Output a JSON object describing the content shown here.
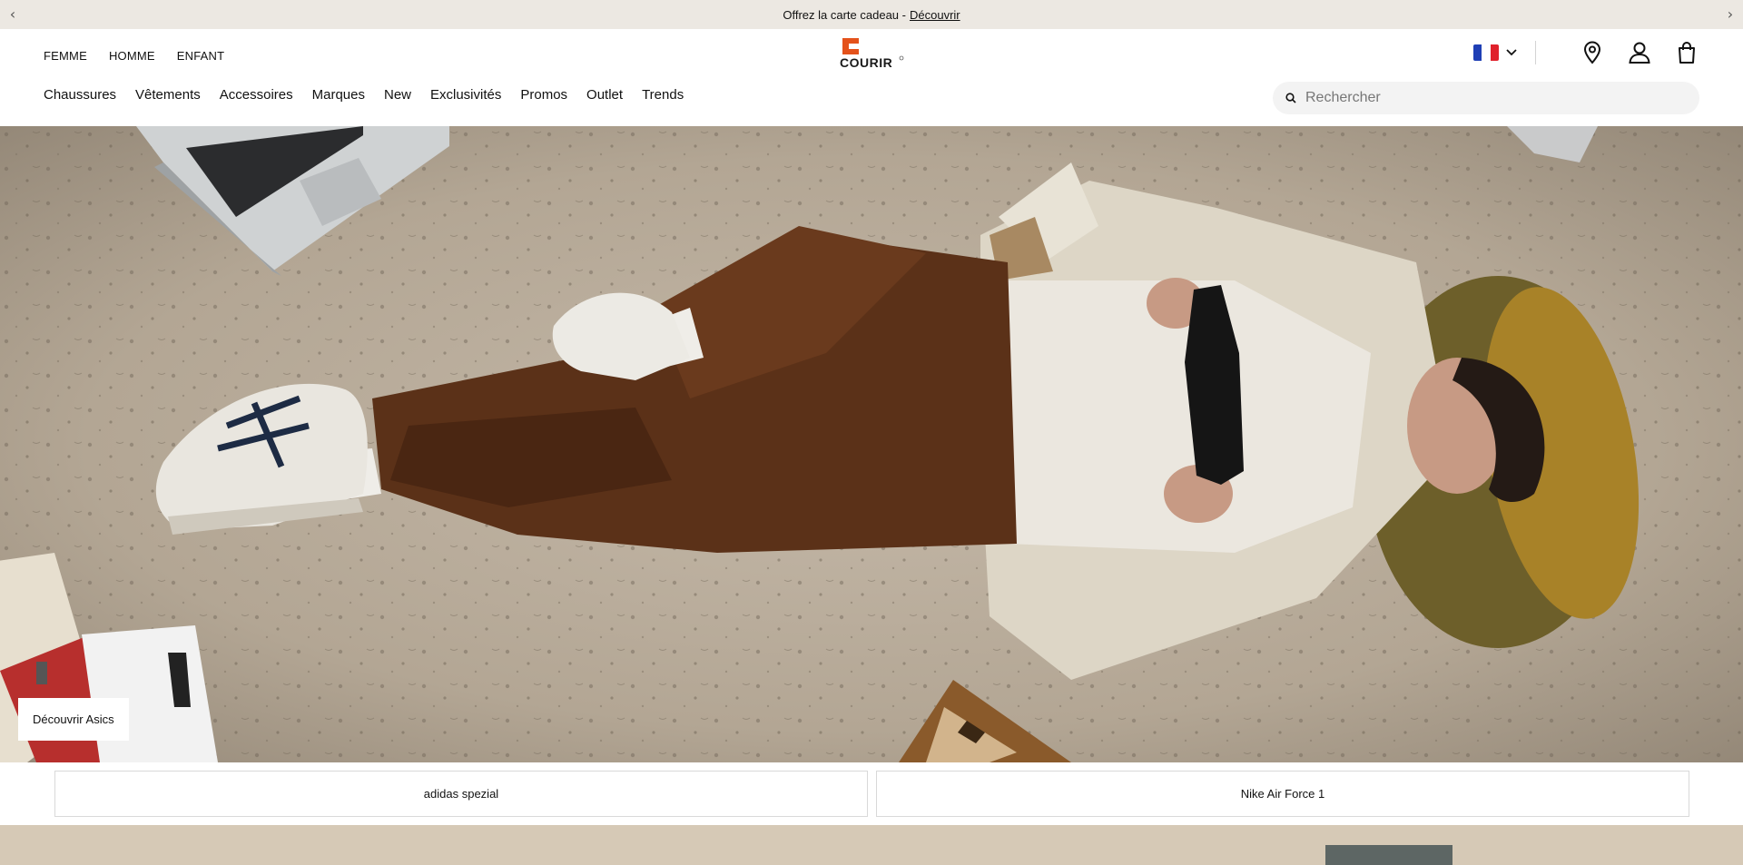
{
  "announcement": {
    "text": "Offrez la carte cadeau - ",
    "link": "Découvrir",
    "prev": "‹",
    "next": "›"
  },
  "header": {
    "gender_nav": [
      "FEMME",
      "HOMME",
      "ENFANT"
    ],
    "logo_text": "COURIR",
    "main_nav": [
      "Chaussures",
      "Vêtements",
      "Accessoires",
      "Marques",
      "New",
      "Exclusivités",
      "Promos",
      "Outlet",
      "Trends"
    ],
    "search_placeholder": "Rechercher"
  },
  "hero": {
    "cta": "Découvrir Asics"
  },
  "tiles": [
    "adidas spezial",
    "Nike Air Force 1"
  ],
  "colors": {
    "announce_bg": "#ece8e2",
    "brand_orange": "#e4521b",
    "search_bg": "#f3f3f3"
  }
}
